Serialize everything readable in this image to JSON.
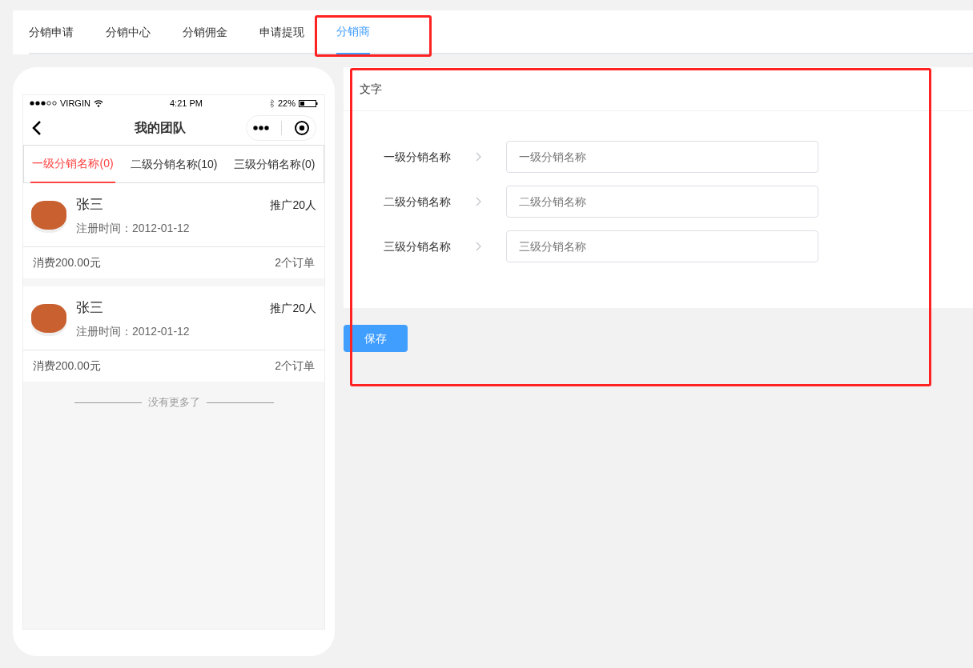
{
  "top_tabs": [
    {
      "label": "分销申请",
      "selected": false,
      "highlighted": false
    },
    {
      "label": "分销中心",
      "selected": false,
      "highlighted": false
    },
    {
      "label": "分销佣金",
      "selected": false,
      "highlighted": false
    },
    {
      "label": "申请提现",
      "selected": false,
      "highlighted": false
    },
    {
      "label": "分销商",
      "selected": true,
      "highlighted": true
    }
  ],
  "phone": {
    "status_bar": {
      "carrier": "VIRGIN",
      "time": "4:21 PM",
      "battery": "22%"
    },
    "title": "我的团队",
    "tabs": [
      {
        "label": "一级分销名称(0)",
        "selected": true
      },
      {
        "label": "二级分销名称(10)",
        "selected": false
      },
      {
        "label": "三级分销名称(0)",
        "selected": false
      }
    ],
    "members": [
      {
        "name": "张三",
        "promoted": "推广20人",
        "registered": "注册时间：2012-01-12",
        "spent": "消费200.00元",
        "orders": "2个订单"
      },
      {
        "name": "张三",
        "promoted": "推广20人",
        "registered": "注册时间：2012-01-12",
        "spent": "消费200.00元",
        "orders": "2个订单"
      }
    ],
    "end_note": "没有更多了"
  },
  "settings": {
    "title": "文字",
    "highlighted": true,
    "fields": [
      {
        "label": "一级分销名称",
        "placeholder": "一级分销名称"
      },
      {
        "label": "二级分销名称",
        "placeholder": "二级分销名称"
      },
      {
        "label": "三级分销名称",
        "placeholder": "三级分销名称"
      }
    ]
  },
  "save_button": "保存"
}
